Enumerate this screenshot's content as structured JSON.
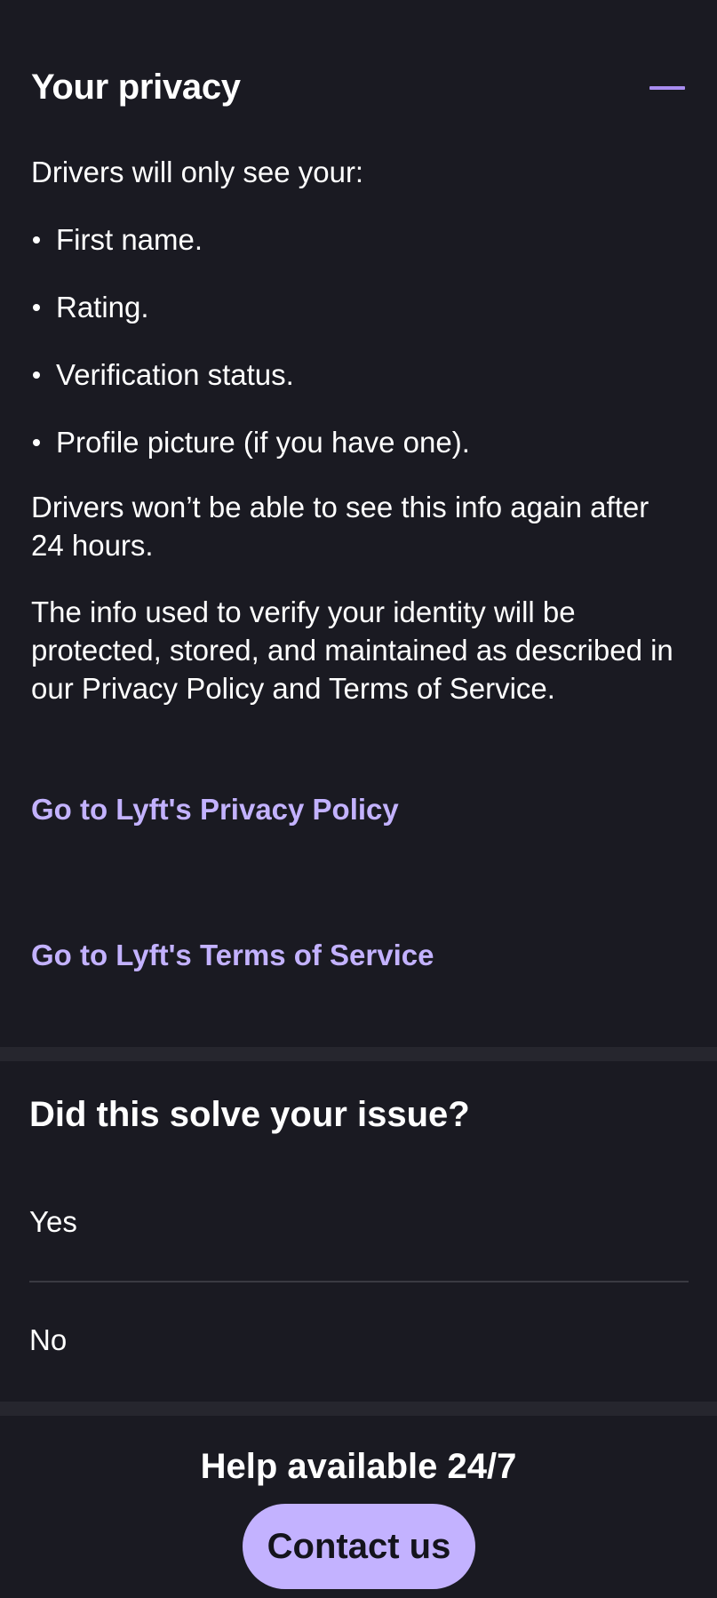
{
  "privacy": {
    "title": "Your privacy",
    "intro": "Drivers will only see your:",
    "bullets": [
      "First name.",
      "Rating.",
      "Verification status.",
      "Profile picture (if you have one)."
    ],
    "paragraph_1": "Drivers won’t be able to see this info again after 24 hours.",
    "paragraph_2": "The info used to verify your identity will be protected, stored, and maintained as described in our Privacy Policy and Terms of Service.",
    "link_privacy": "Go to Lyft's Privacy Policy",
    "link_terms": "Go to Lyft's Terms of Service",
    "collapse_icon": "minus-icon"
  },
  "feedback": {
    "title": "Did this solve your issue?",
    "yes_label": "Yes",
    "no_label": "No"
  },
  "help": {
    "title": "Help available 24/7",
    "contact_label": "Contact us"
  },
  "colors": {
    "background": "#1a1a22",
    "accent": "#c3b2ff",
    "text": "#ffffff"
  }
}
